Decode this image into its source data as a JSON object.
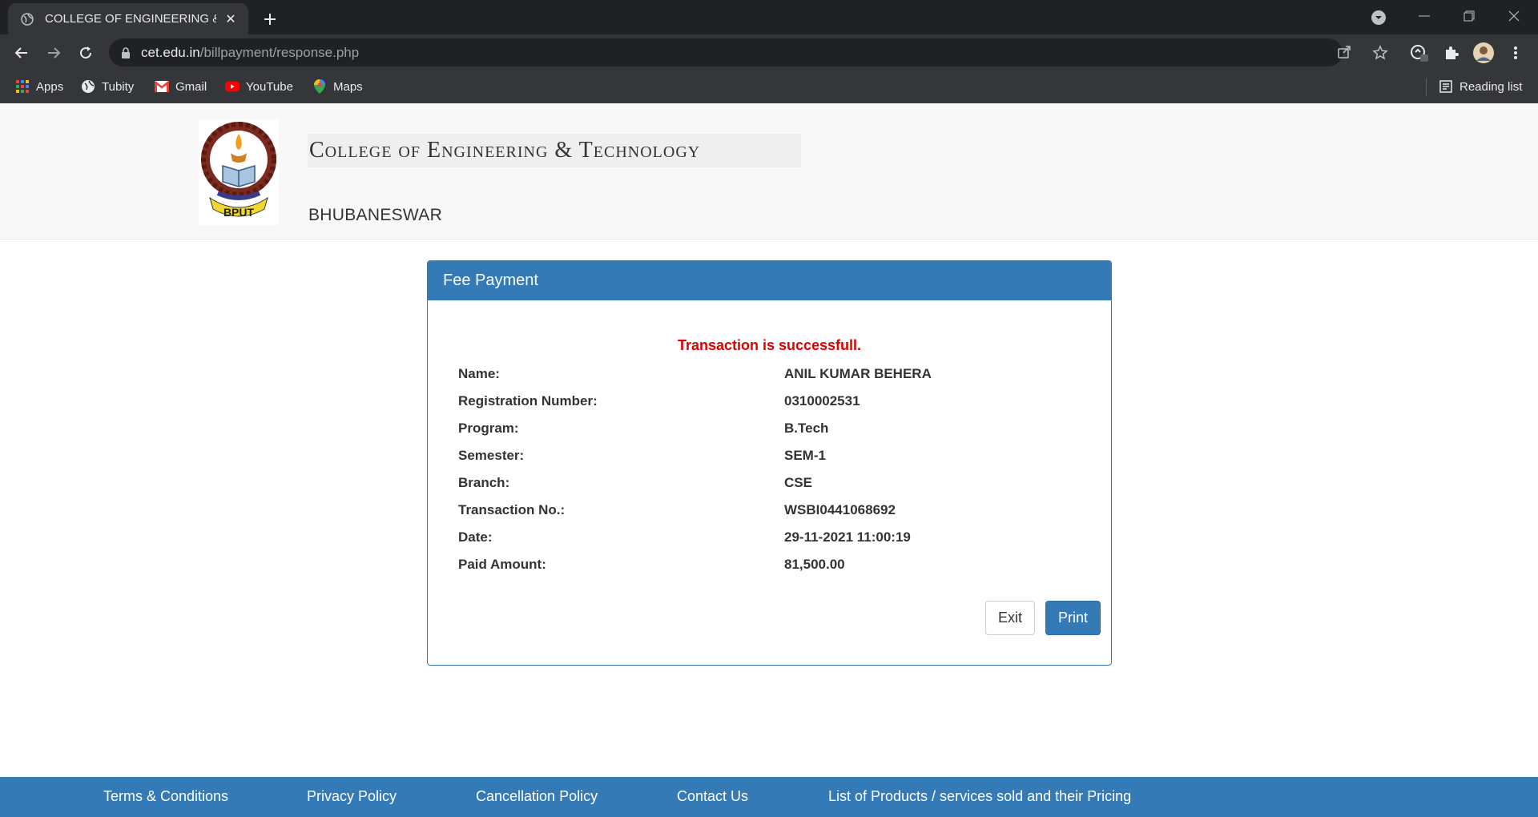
{
  "browser": {
    "tab_title": "COLLEGE OF ENGINEERING & TECHNOLOGY",
    "url_host": "cet.edu.in",
    "url_path": "/billpayment/response.php",
    "bookmarks": [
      {
        "label": "Apps",
        "icon": "apps-grid-icon"
      },
      {
        "label": "Tubity",
        "icon": "globe-icon"
      },
      {
        "label": "Gmail",
        "icon": "gmail-icon"
      },
      {
        "label": "YouTube",
        "icon": "youtube-icon"
      },
      {
        "label": "Maps",
        "icon": "maps-pin-icon"
      }
    ],
    "reading_list": "Reading list"
  },
  "header": {
    "college_name": "College of Engineering & Technology",
    "city": "BHUBANESWAR",
    "logo_text": "BPUT"
  },
  "panel": {
    "title": "Fee Payment",
    "status_message": "Transaction is successfull.",
    "details": [
      {
        "label": "Name:",
        "value": "ANIL KUMAR BEHERA"
      },
      {
        "label": "Registration Number:",
        "value": "0310002531"
      },
      {
        "label": "Program:",
        "value": "B.Tech"
      },
      {
        "label": "Semester:",
        "value": "SEM-1"
      },
      {
        "label": "Branch:",
        "value": "CSE"
      },
      {
        "label": "Transaction No.:",
        "value": "WSBI0441068692"
      },
      {
        "label": "Date:",
        "value": "29-11-2021 11:00:19"
      },
      {
        "label": "Paid Amount:",
        "value": "81,500.00"
      }
    ],
    "exit_label": "Exit",
    "print_label": "Print"
  },
  "footer": {
    "links": [
      "Terms & Conditions",
      "Privacy Policy",
      "Cancellation Policy",
      "Contact Us",
      "List of Products / services sold and their Pricing"
    ]
  },
  "colors": {
    "brand_blue": "#337ab7",
    "success_red": "#e00000",
    "chrome_dark": "#202124",
    "chrome_toolbar": "#35363a"
  }
}
